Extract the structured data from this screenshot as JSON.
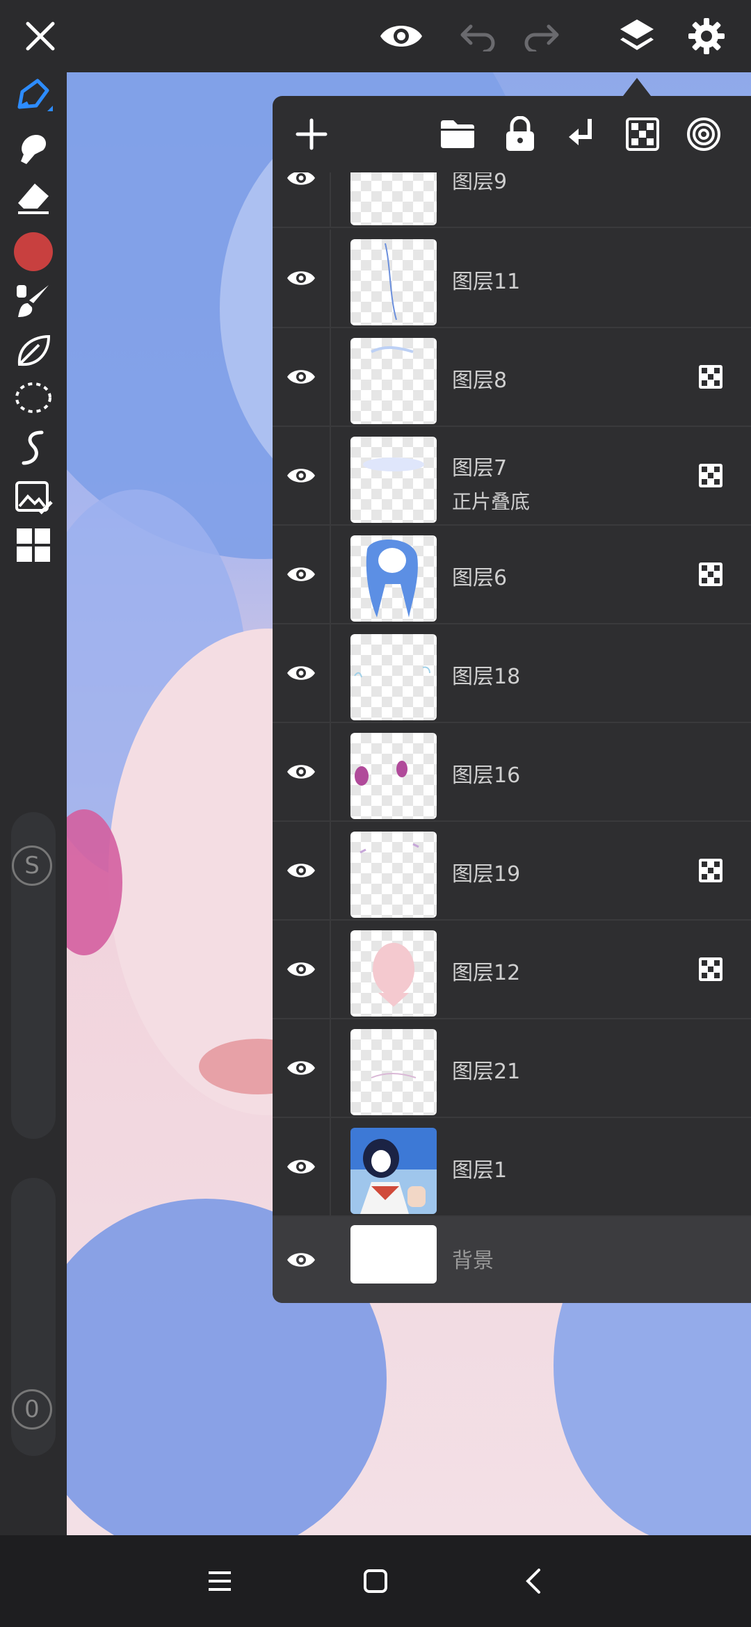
{
  "layers": [
    {
      "name": "图层9",
      "mode": "",
      "clipping": false,
      "visible": true
    },
    {
      "name": "图层11",
      "mode": "",
      "clipping": false,
      "visible": true
    },
    {
      "name": "图层8",
      "mode": "",
      "clipping": true,
      "visible": true
    },
    {
      "name": "图层7",
      "mode": "正片叠底",
      "clipping": true,
      "visible": true
    },
    {
      "name": "图层6",
      "mode": "",
      "clipping": true,
      "visible": true
    },
    {
      "name": "图层18",
      "mode": "",
      "clipping": false,
      "visible": true
    },
    {
      "name": "图层16",
      "mode": "",
      "clipping": false,
      "visible": true
    },
    {
      "name": "图层19",
      "mode": "",
      "clipping": true,
      "visible": true
    },
    {
      "name": "图层12",
      "mode": "",
      "clipping": true,
      "visible": true
    },
    {
      "name": "图层21",
      "mode": "",
      "clipping": false,
      "visible": true
    },
    {
      "name": "图层1",
      "mode": "",
      "clipping": false,
      "visible": true
    }
  ],
  "background_layer": {
    "name": "背景",
    "visible": true
  },
  "toolbar": {
    "tools": [
      "brush-icon",
      "smudge-icon",
      "eraser-icon",
      "color-swatch",
      "paint-brush-icon",
      "leaf-icon",
      "lasso-icon",
      "curve-icon",
      "image-edit-icon",
      "grid-icon"
    ],
    "color": "#c8403f",
    "badge_s": "S",
    "badge_0": "0"
  },
  "colors": {
    "accent": "#1e90ff",
    "panel": "#2e2e30",
    "bar": "#2b2b2d"
  }
}
